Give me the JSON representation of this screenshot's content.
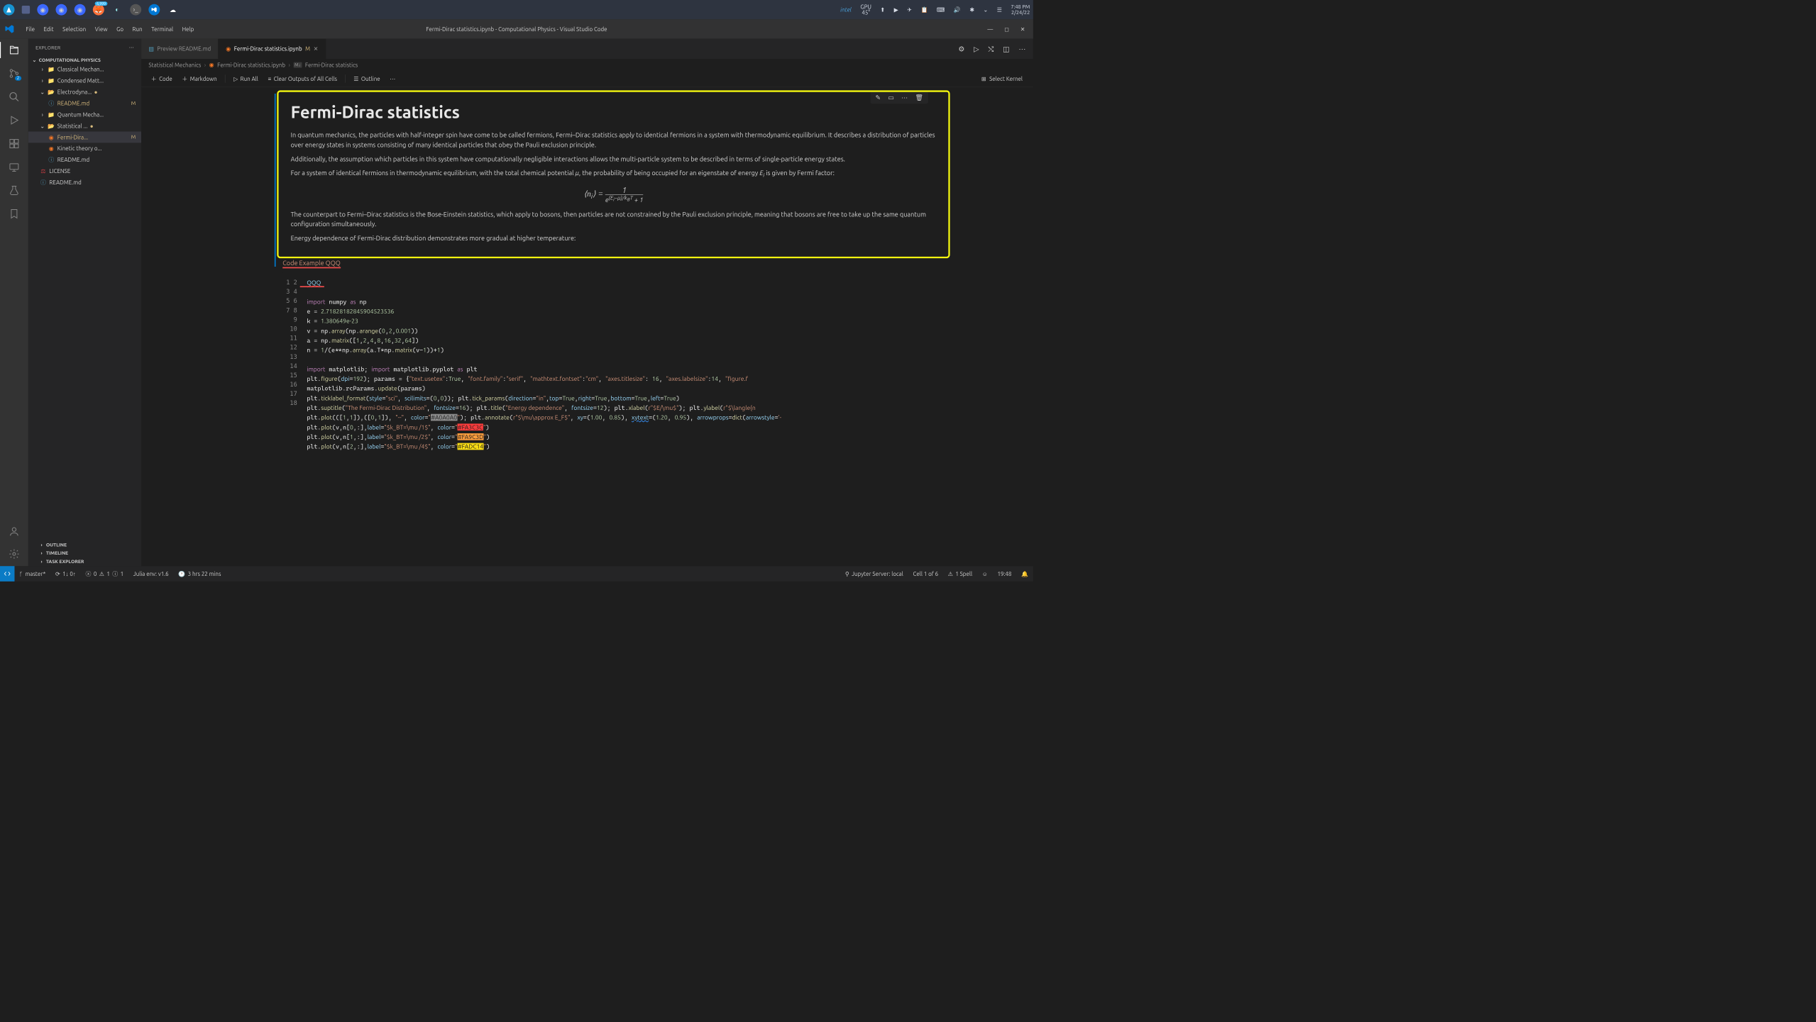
{
  "taskbar": {
    "gpu_label": "GPU",
    "gpu_temp": "45°",
    "intel": "intel",
    "time": "7:48 PM",
    "date": "2/24/22"
  },
  "menu": {
    "file": "File",
    "edit": "Edit",
    "selection": "Selection",
    "view": "View",
    "go": "Go",
    "run": "Run",
    "terminal": "Terminal",
    "help": "Help"
  },
  "window_title": "Fermi-Dirac statistics.ipynb - Computational Physics - Visual Studio Code",
  "explorer": {
    "title": "EXPLORER",
    "section": "COMPUTATIONAL PHYSICS",
    "folders": {
      "classical": "Classical Mechan...",
      "condensed": "Condensed Matt...",
      "electro": "Electrodyna...",
      "quantum": "Quantum Mecha...",
      "stat": "Statistical ..."
    },
    "files": {
      "readme_el": "README.md",
      "fermi": "Fermi-Dira...",
      "kinetic": "Kinetic theory o...",
      "readme_st": "README.md",
      "license": "LICENSE",
      "readme_root": "README.md"
    },
    "outline": "OUTLINE",
    "timeline": "TIMELINE",
    "task": "TASK EXPLORER",
    "m": "M"
  },
  "tabs": {
    "t1": "Preview README.md",
    "t2": "Fermi-Dirac statistics.ipynb",
    "t2_mod": "M"
  },
  "breadcrumb": {
    "a": "Statistical Mechanics",
    "b": "Fermi-Dirac statistics.ipynb",
    "c": "Fermi-Dirac statistics",
    "md": "M↓"
  },
  "nbtoolbar": {
    "code": "Code",
    "markdown": "Markdown",
    "runall": "Run All",
    "clear": "Clear Outputs of All Cells",
    "outline": "Outline",
    "kernel": "Select Kernel"
  },
  "md": {
    "h1": "Fermi-Dirac statistics",
    "p1": "In quantum mechanics, the particles with half-integer spin have come to be called fermions, Fermi–Dirac statistics apply to identical fermions in a system with thermodynamic equilibrium. It describes a distribution of particles over energy states in systems consisting of many identical particles that obey the Pauli exclusion principle.",
    "p2": "Additionally, the assumption which particles in this system have computationally negligible interactions allows the multi-particle system to be described in terms of single-particle energy states.",
    "p3a": "For a system of identical fermions in thermodynamic equilibrium, with the total chemical potential ",
    "p3b": ", the probability of being occupied for an eigenstate of energy ",
    "p3c": " is given by Fermi factor:",
    "p4": "The counterpart to Fermi–Dirac statistics is the Bose-Einstein statistics, which apply to bosons, then particles are not constrained by the Pauli exclusion principle, meaning that bosons are free to take up the same quantum configuration simultaneously.",
    "p5": "Energy dependence of Fermi-Dirac distribution demonstrates more gradual at higher temperature:"
  },
  "snippet": "Code Example QQQ",
  "status": {
    "branch": "master*",
    "sync": "1↓ 0↑",
    "errors": "0",
    "warnings": "1",
    "info": "1",
    "julia": "Julia env: v1.6",
    "time_tracked": "3 hrs 22 mins",
    "jupyter": "Jupyter Server: local",
    "cell": "Cell 1 of 6",
    "spell": "1 Spell",
    "clock": "19:48"
  }
}
